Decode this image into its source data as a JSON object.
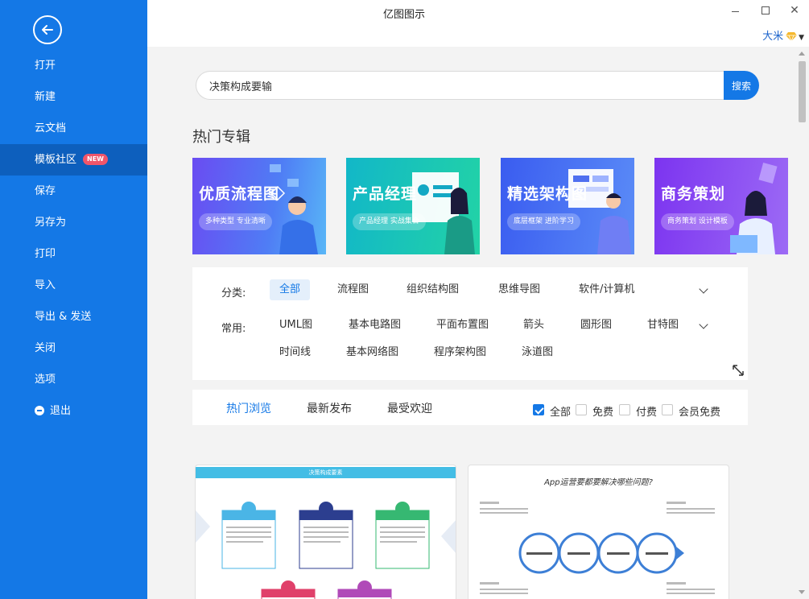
{
  "app": {
    "title": "亿图图示"
  },
  "user": {
    "name": "大米"
  },
  "sidebar": {
    "items": [
      {
        "label": "打开"
      },
      {
        "label": "新建"
      },
      {
        "label": "云文档"
      },
      {
        "label": "模板社区",
        "badge": "NEW",
        "active": true
      },
      {
        "label": "保存"
      },
      {
        "label": "另存为"
      },
      {
        "label": "打印"
      },
      {
        "label": "导入"
      },
      {
        "label": "导出 & 发送"
      },
      {
        "label": "关闭"
      },
      {
        "label": "选项"
      },
      {
        "label": "退出"
      }
    ]
  },
  "search": {
    "value": "决策构成要输",
    "button_label": "搜索"
  },
  "hot_albums": {
    "title": "热门专辑",
    "banners": [
      {
        "title": "优质流程图",
        "subtitle": "多种类型 专业清晰",
        "color": "#6b5cf0"
      },
      {
        "title": "产品经理",
        "subtitle": "产品经理 实战集合",
        "color": "#16c2b2"
      },
      {
        "title": "精选架构图",
        "subtitle": "底层框架 进阶学习",
        "color": "#4a63f0"
      },
      {
        "title": "商务策划",
        "subtitle": "商务策划 设计模板",
        "color": "#8a3df0"
      }
    ]
  },
  "filters": {
    "category_label": "分类:",
    "categories": [
      "全部",
      "流程图",
      "组织结构图",
      "思维导图",
      "软件/计算机"
    ],
    "common_label": "常用:",
    "common_row1": [
      "UML图",
      "基本电路图",
      "平面布置图",
      "箭头",
      "圆形图",
      "甘特图"
    ],
    "common_row2": [
      "时间线",
      "基本网络图",
      "程序架构图",
      "泳道图"
    ]
  },
  "sort": {
    "tabs": [
      "热门浏览",
      "最新发布",
      "最受欢迎"
    ],
    "checkboxes": [
      {
        "label": "全部",
        "checked": true
      },
      {
        "label": "免费",
        "checked": false
      },
      {
        "label": "付费",
        "checked": false
      },
      {
        "label": "会员免费",
        "checked": false
      }
    ]
  },
  "templates": [
    {
      "title": "决策构成要素"
    },
    {
      "title": "App运营要都要解决哪些问题?"
    }
  ],
  "colors": {
    "accent": "#1478e6",
    "sidebar": "#1478e6",
    "sidebar_active": "#0d5fbd"
  }
}
